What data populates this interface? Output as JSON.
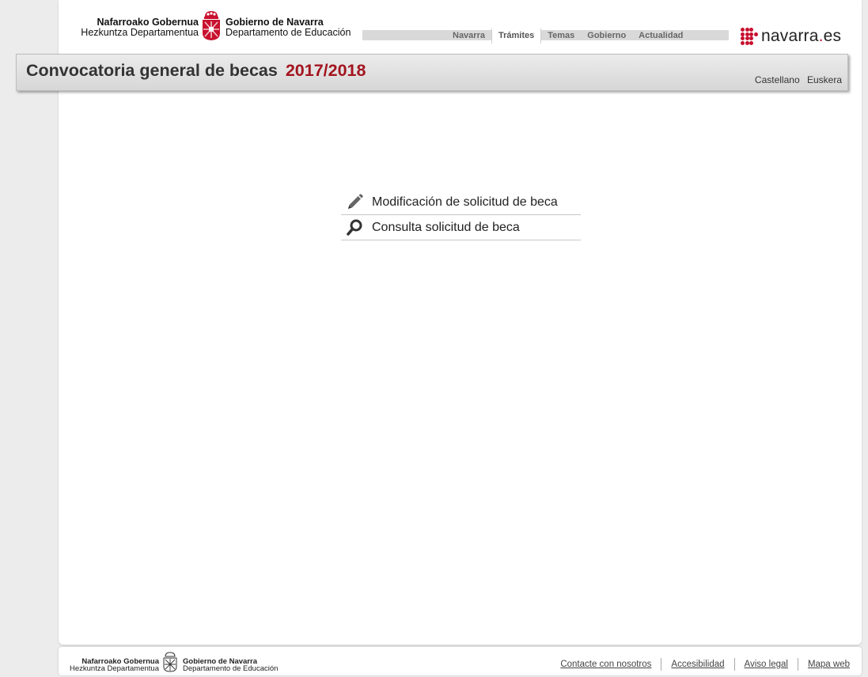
{
  "header": {
    "logo_left_line1": "Nafarroako Gobernua",
    "logo_left_line2": "Hezkuntza Departamentua",
    "logo_right_line1": "Gobierno de Navarra",
    "logo_right_line2": "Departamento de Educación",
    "nav": [
      {
        "label": "Navarra",
        "active": false
      },
      {
        "label": "Trámites",
        "active": true
      },
      {
        "label": "Temas",
        "active": false
      },
      {
        "label": "Gobierno",
        "active": false
      },
      {
        "label": "Actualidad",
        "active": false
      }
    ],
    "portal_logo_text": "navarra",
    "portal_logo_dot": ".",
    "portal_logo_suffix": "es",
    "brand_color": "#c8102e"
  },
  "title_bar": {
    "title": "Convocatoria general de becas",
    "year": "2017/2018",
    "year_color": "#a3141f",
    "languages": [
      "Castellano",
      "Euskera"
    ]
  },
  "menu": {
    "items": [
      {
        "label": "Modificación de solicitud de beca",
        "icon": "pencil-icon"
      },
      {
        "label": "Consulta solicitud de beca",
        "icon": "magnifier-icon"
      }
    ]
  },
  "footer": {
    "logo_left_line1": "Nafarroako Gobernua",
    "logo_left_line2": "Hezkuntza Departamentua",
    "logo_right_line1": "Gobierno de Navarra",
    "logo_right_line2": "Departamento de Educación",
    "links": [
      "Contacte con nosotros",
      "Accesibilidad",
      "Aviso legal",
      "Mapa web"
    ]
  }
}
